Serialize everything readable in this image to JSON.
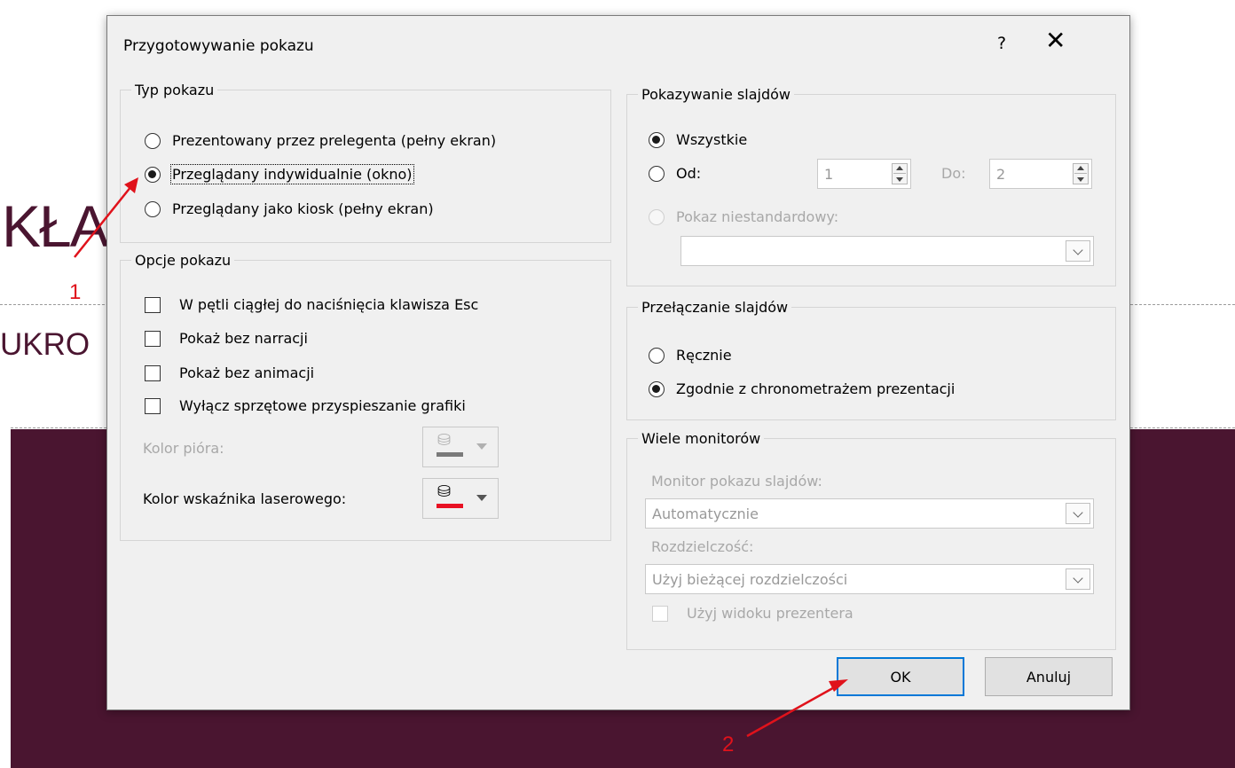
{
  "background": {
    "big_text": "KŁA",
    "sub_text": "UKRO",
    "annotation_1": "1",
    "annotation_2": "2",
    "band_color": "#4a1530",
    "arrow_color": "#e0121b"
  },
  "dialog": {
    "title": "Przygotowywanie pokazu",
    "help_label": "?",
    "close_label": "✕",
    "show_type": {
      "legend": "Typ pokazu",
      "options": [
        {
          "label": "Prezentowany przez prelegenta (pełny ekran)",
          "selected": false
        },
        {
          "label": "Przeglądany indywidualnie (okno)",
          "selected": true
        },
        {
          "label": "Przeglądany jako kiosk (pełny ekran)",
          "selected": false
        }
      ]
    },
    "show_options": {
      "legend": "Opcje pokazu",
      "checkboxes": [
        {
          "label": "W pętli ciągłej do naciśnięcia klawisza Esc",
          "checked": false
        },
        {
          "label": "Pokaż bez narracji",
          "checked": false
        },
        {
          "label": "Pokaż bez animacji",
          "checked": false
        },
        {
          "label": "Wyłącz sprzętowe przyspieszanie grafiki",
          "checked": false
        }
      ],
      "pen_color_label": "Kolor pióra:",
      "pen_color": "#7a7a7a",
      "laser_color_label": "Kolor wskaźnika laserowego:",
      "laser_color": "#e81123"
    },
    "show_slides": {
      "legend": "Pokazywanie slajdów",
      "all_label": "Wszystkie",
      "from_label": "Od:",
      "from_value": "1",
      "to_label": "Do:",
      "to_value": "2",
      "custom_label": "Pokaz niestandardowy:",
      "custom_value": ""
    },
    "advance_slides": {
      "legend": "Przełączanie slajdów",
      "manual_label": "Ręcznie",
      "timings_label": "Zgodnie z chronometrażem prezentacji"
    },
    "monitors": {
      "legend": "Wiele monitorów",
      "monitor_label": "Monitor pokazu slajdów:",
      "monitor_value": "Automatycznie",
      "resolution_label": "Rozdzielczość:",
      "resolution_value": "Użyj bieżącej rozdzielczości",
      "presenter_view_label": "Użyj widoku prezentera"
    },
    "ok_label": "OK",
    "cancel_label": "Anuluj"
  }
}
